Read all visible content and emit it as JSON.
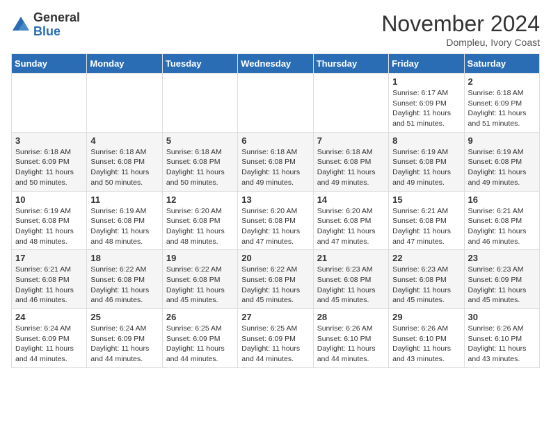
{
  "logo": {
    "general": "General",
    "blue": "Blue"
  },
  "title": "November 2024",
  "subtitle": "Dompleu, Ivory Coast",
  "days_of_week": [
    "Sunday",
    "Monday",
    "Tuesday",
    "Wednesday",
    "Thursday",
    "Friday",
    "Saturday"
  ],
  "weeks": [
    [
      {
        "day": "",
        "info": ""
      },
      {
        "day": "",
        "info": ""
      },
      {
        "day": "",
        "info": ""
      },
      {
        "day": "",
        "info": ""
      },
      {
        "day": "",
        "info": ""
      },
      {
        "day": "1",
        "info": "Sunrise: 6:17 AM\nSunset: 6:09 PM\nDaylight: 11 hours and 51 minutes."
      },
      {
        "day": "2",
        "info": "Sunrise: 6:18 AM\nSunset: 6:09 PM\nDaylight: 11 hours and 51 minutes."
      }
    ],
    [
      {
        "day": "3",
        "info": "Sunrise: 6:18 AM\nSunset: 6:09 PM\nDaylight: 11 hours and 50 minutes."
      },
      {
        "day": "4",
        "info": "Sunrise: 6:18 AM\nSunset: 6:08 PM\nDaylight: 11 hours and 50 minutes."
      },
      {
        "day": "5",
        "info": "Sunrise: 6:18 AM\nSunset: 6:08 PM\nDaylight: 11 hours and 50 minutes."
      },
      {
        "day": "6",
        "info": "Sunrise: 6:18 AM\nSunset: 6:08 PM\nDaylight: 11 hours and 49 minutes."
      },
      {
        "day": "7",
        "info": "Sunrise: 6:18 AM\nSunset: 6:08 PM\nDaylight: 11 hours and 49 minutes."
      },
      {
        "day": "8",
        "info": "Sunrise: 6:19 AM\nSunset: 6:08 PM\nDaylight: 11 hours and 49 minutes."
      },
      {
        "day": "9",
        "info": "Sunrise: 6:19 AM\nSunset: 6:08 PM\nDaylight: 11 hours and 49 minutes."
      }
    ],
    [
      {
        "day": "10",
        "info": "Sunrise: 6:19 AM\nSunset: 6:08 PM\nDaylight: 11 hours and 48 minutes."
      },
      {
        "day": "11",
        "info": "Sunrise: 6:19 AM\nSunset: 6:08 PM\nDaylight: 11 hours and 48 minutes."
      },
      {
        "day": "12",
        "info": "Sunrise: 6:20 AM\nSunset: 6:08 PM\nDaylight: 11 hours and 48 minutes."
      },
      {
        "day": "13",
        "info": "Sunrise: 6:20 AM\nSunset: 6:08 PM\nDaylight: 11 hours and 47 minutes."
      },
      {
        "day": "14",
        "info": "Sunrise: 6:20 AM\nSunset: 6:08 PM\nDaylight: 11 hours and 47 minutes."
      },
      {
        "day": "15",
        "info": "Sunrise: 6:21 AM\nSunset: 6:08 PM\nDaylight: 11 hours and 47 minutes."
      },
      {
        "day": "16",
        "info": "Sunrise: 6:21 AM\nSunset: 6:08 PM\nDaylight: 11 hours and 46 minutes."
      }
    ],
    [
      {
        "day": "17",
        "info": "Sunrise: 6:21 AM\nSunset: 6:08 PM\nDaylight: 11 hours and 46 minutes."
      },
      {
        "day": "18",
        "info": "Sunrise: 6:22 AM\nSunset: 6:08 PM\nDaylight: 11 hours and 46 minutes."
      },
      {
        "day": "19",
        "info": "Sunrise: 6:22 AM\nSunset: 6:08 PM\nDaylight: 11 hours and 45 minutes."
      },
      {
        "day": "20",
        "info": "Sunrise: 6:22 AM\nSunset: 6:08 PM\nDaylight: 11 hours and 45 minutes."
      },
      {
        "day": "21",
        "info": "Sunrise: 6:23 AM\nSunset: 6:08 PM\nDaylight: 11 hours and 45 minutes."
      },
      {
        "day": "22",
        "info": "Sunrise: 6:23 AM\nSunset: 6:08 PM\nDaylight: 11 hours and 45 minutes."
      },
      {
        "day": "23",
        "info": "Sunrise: 6:23 AM\nSunset: 6:09 PM\nDaylight: 11 hours and 45 minutes."
      }
    ],
    [
      {
        "day": "24",
        "info": "Sunrise: 6:24 AM\nSunset: 6:09 PM\nDaylight: 11 hours and 44 minutes."
      },
      {
        "day": "25",
        "info": "Sunrise: 6:24 AM\nSunset: 6:09 PM\nDaylight: 11 hours and 44 minutes."
      },
      {
        "day": "26",
        "info": "Sunrise: 6:25 AM\nSunset: 6:09 PM\nDaylight: 11 hours and 44 minutes."
      },
      {
        "day": "27",
        "info": "Sunrise: 6:25 AM\nSunset: 6:09 PM\nDaylight: 11 hours and 44 minutes."
      },
      {
        "day": "28",
        "info": "Sunrise: 6:26 AM\nSunset: 6:10 PM\nDaylight: 11 hours and 44 minutes."
      },
      {
        "day": "29",
        "info": "Sunrise: 6:26 AM\nSunset: 6:10 PM\nDaylight: 11 hours and 43 minutes."
      },
      {
        "day": "30",
        "info": "Sunrise: 6:26 AM\nSunset: 6:10 PM\nDaylight: 11 hours and 43 minutes."
      }
    ]
  ]
}
